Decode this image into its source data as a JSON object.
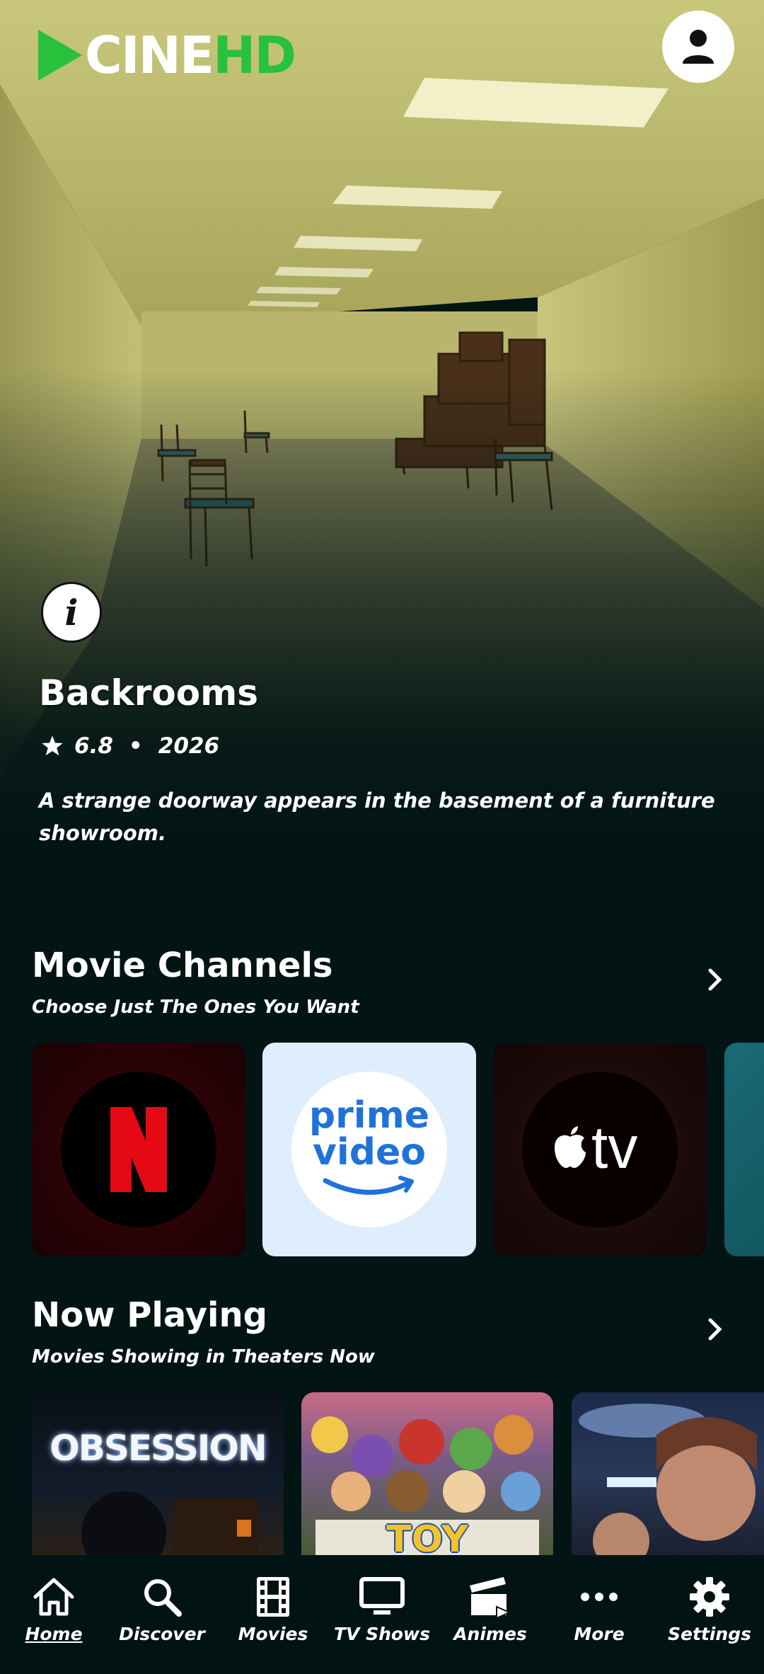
{
  "app": {
    "logo_main": "CINE",
    "logo_accent": "HD",
    "brand_color": "#27c13b"
  },
  "hero": {
    "title": "Backrooms",
    "rating": "6.8",
    "separator": "•",
    "year": "2026",
    "description": "A strange doorway appears in the basement of a furniture showroom."
  },
  "sections": {
    "channels": {
      "title": "Movie Channels",
      "subtitle": "Choose Just The Ones You Want",
      "items": [
        {
          "name": "Netflix",
          "logo_letter": "N",
          "color": "#e50914"
        },
        {
          "name": "Prime Video",
          "logo_line1": "prime",
          "logo_line2": "video",
          "color": "#1f73d8"
        },
        {
          "name": "Apple TV",
          "logo_text": "tv",
          "color": "#ffffff"
        }
      ]
    },
    "now_playing": {
      "title": "Now Playing",
      "subtitle": "Movies Showing in Theaters Now",
      "posters": [
        {
          "title_text": "OBSESSION"
        },
        {
          "title_text": "TOY"
        },
        {
          "title_text": ""
        }
      ]
    }
  },
  "nav": {
    "items": [
      {
        "label": "Home",
        "icon": "home-icon",
        "active": true
      },
      {
        "label": "Discover",
        "icon": "search-icon"
      },
      {
        "label": "Movies",
        "icon": "film-icon"
      },
      {
        "label": "TV Shows",
        "icon": "tv-icon"
      },
      {
        "label": "Animes",
        "icon": "clapperboard-icon"
      },
      {
        "label": "More",
        "icon": "more-icon"
      },
      {
        "label": "Settings",
        "icon": "gear-icon"
      }
    ]
  }
}
